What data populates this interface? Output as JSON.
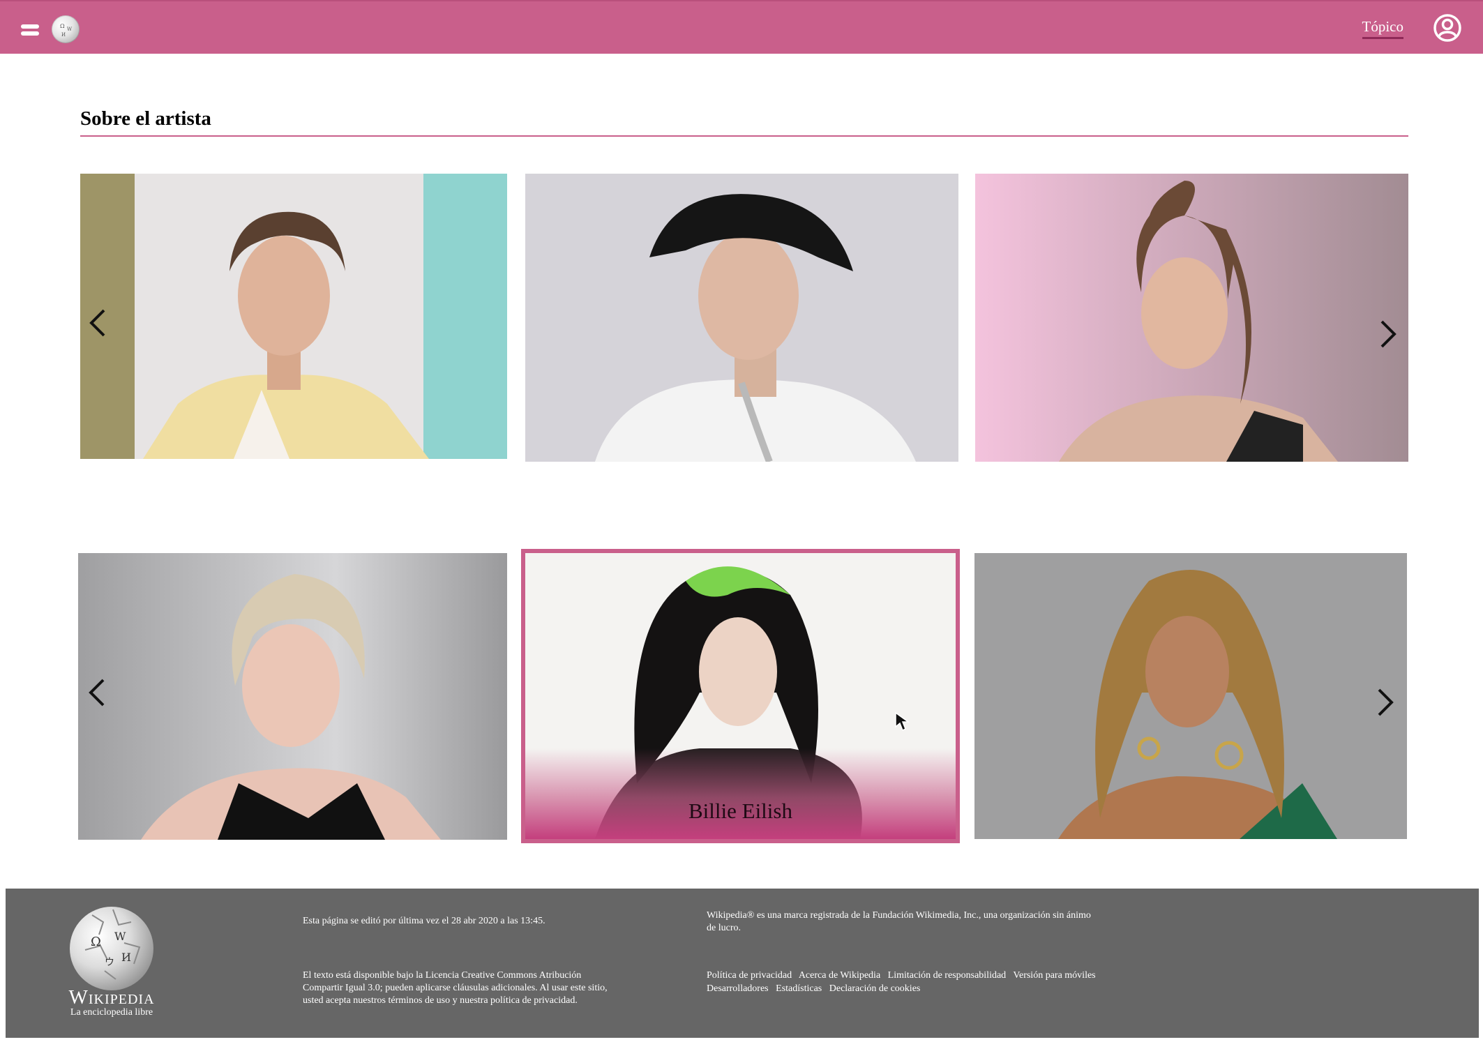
{
  "header": {
    "topic_link": "Tópico",
    "accent_color": "#c95f8b",
    "icons": [
      "menu-icon",
      "wikipedia-globe-icon",
      "user-account-icon"
    ]
  },
  "section": {
    "title": "Sobre el artista"
  },
  "gallery": {
    "row1": [
      {
        "alt": "artist-portrait-1"
      },
      {
        "alt": "artist-portrait-2"
      },
      {
        "alt": "artist-portrait-3"
      }
    ],
    "row2": [
      {
        "alt": "artist-portrait-4"
      },
      {
        "alt": "artist-portrait-5",
        "caption": "Billie Eilish",
        "selected": true
      },
      {
        "alt": "artist-portrait-6"
      }
    ]
  },
  "footer": {
    "wordmark": "Wikipedia",
    "tagline": "La enciclopedia libre",
    "last_edit": "Esta página se editó por última vez el 28 abr 2020 a las 13:45.",
    "license": "El texto está disponible bajo la Licencia Creative Commons Atribución Compartir Igual 3.0; pueden aplicarse cláusulas adicionales. Al usar este sitio, usted acepta nuestros términos de uso y nuestra política de privacidad.",
    "trademark": "Wikipedia® es una marca registrada de la Fundación Wikimedia, Inc., una organización sin ánimo de lucro.",
    "links_row1": [
      "Política de privacidad",
      "Acerca de Wikipedia",
      "Limitación de responsabilidad",
      "Versión para móviles"
    ],
    "links_row2": [
      "Desarrolladores",
      "Estadísticas",
      "Declaración de cookies"
    ]
  }
}
